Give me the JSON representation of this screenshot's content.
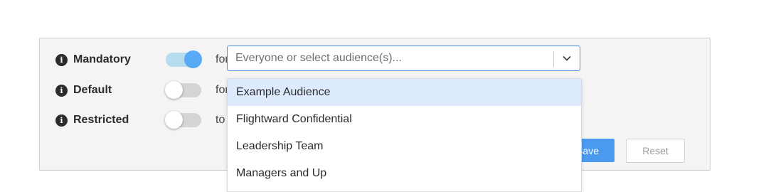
{
  "rows": [
    {
      "info_icon": "i",
      "label": "Mandatory",
      "toggle_on": true,
      "conjunction": "for"
    },
    {
      "info_icon": "i",
      "label": "Default",
      "toggle_on": false,
      "conjunction": "for"
    },
    {
      "info_icon": "i",
      "label": "Restricted",
      "toggle_on": false,
      "conjunction": "to"
    }
  ],
  "audience_select": {
    "placeholder": "Everyone or select audience(s)...",
    "icon": "chevron-down-icon"
  },
  "dropdown": {
    "items": [
      "Example Audience",
      "Flightward Confidential",
      "Leadership Team",
      "Managers and Up"
    ],
    "highlighted_index": 0
  },
  "buttons": {
    "save_label": "Save",
    "reset_label": "Reset"
  },
  "colors": {
    "accent": "#4a9af0",
    "toggle_on_track": "#b7dbef",
    "toggle_on_knob": "#58aaf6",
    "highlight": "#deebff"
  }
}
